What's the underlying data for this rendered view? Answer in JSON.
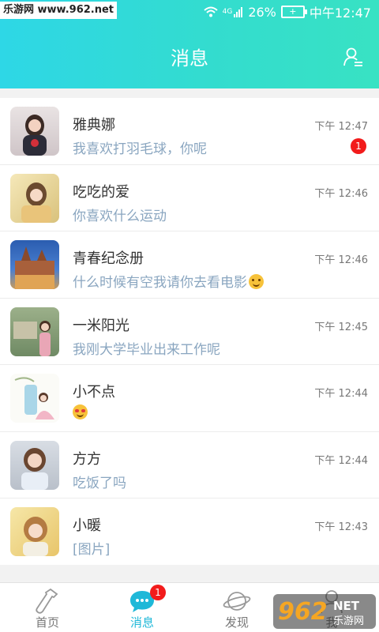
{
  "watermark": "乐游网 www.962.net",
  "status_bar": {
    "network": "4G",
    "battery": "26%",
    "time": "中午12:47"
  },
  "header": {
    "title": "消息"
  },
  "conversations": [
    {
      "name": "雅典娜",
      "message": "我喜欢打羽毛球，你呢",
      "time": "下午 12:47",
      "unread": "1"
    },
    {
      "name": "吃吃的爱",
      "message": "你喜欢什么运动",
      "time": "下午 12:46"
    },
    {
      "name": "青春纪念册",
      "message": "什么时候有空我请你去看电影",
      "time": "下午 12:46",
      "emoji": "smile"
    },
    {
      "name": "一米阳光",
      "message": "我刚大学毕业出来工作呢",
      "time": "下午 12:45"
    },
    {
      "name": "小不点",
      "message": "",
      "time": "下午 12:44",
      "emoji": "heart-eyes"
    },
    {
      "name": "方方",
      "message": "吃饭了吗",
      "time": "下午 12:44"
    },
    {
      "name": "小暖",
      "message": "[图片]",
      "time": "下午 12:43"
    }
  ],
  "tabs": [
    {
      "label": "首页",
      "icon": "bottle-icon"
    },
    {
      "label": "消息",
      "icon": "chat-bubble-icon",
      "badge": "1",
      "active": true
    },
    {
      "label": "发现",
      "icon": "planet-icon"
    },
    {
      "label": "我",
      "icon": "person-icon"
    }
  ],
  "overlay_logo": {
    "text": "962",
    "suffix": "NET",
    "caption": "乐游网"
  },
  "colors": {
    "accent": "#1fb8d8",
    "badge": "#f21b1b",
    "header_start": "#2ed7e6",
    "header_end": "#38e2c3"
  }
}
